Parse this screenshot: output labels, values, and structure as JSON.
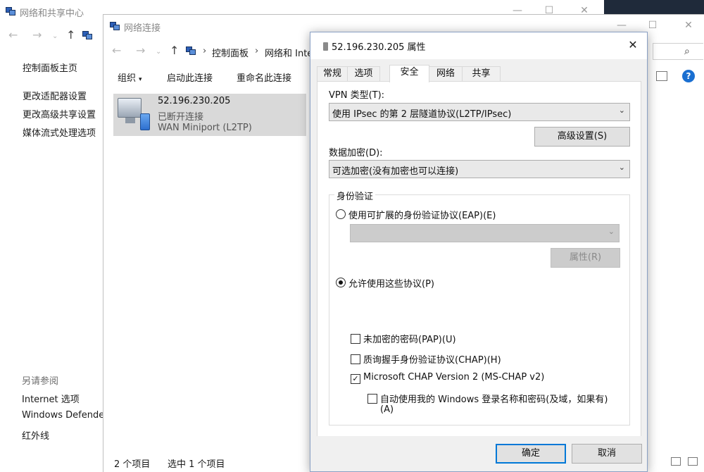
{
  "bg_window": {
    "title": "网络和共享中心",
    "sidebar": {
      "home_link": "控制面板主页",
      "links": [
        "更改适配器设置",
        "更改高级共享设置",
        "媒体流式处理选项"
      ],
      "see_also_label": "另请参阅",
      "see_also_links": [
        "Internet 选项",
        "Windows Defende",
        "红外线"
      ]
    }
  },
  "mid_window": {
    "title": "网络连接",
    "address": {
      "crumb1": "控制面板",
      "crumb2": "网络和 Inte",
      "separator": "›"
    },
    "toolbar": {
      "organize": "组织",
      "enable_connection": "启动此连接",
      "rename_connection": "重命名此连接"
    },
    "connection": {
      "name": "52.196.230.205",
      "status": "已断开连接",
      "device": "WAN Miniport (L2TP)"
    },
    "statusbar": {
      "item_count": "2 个项目",
      "selected_count": "选中 1 个项目"
    },
    "help_glyph": "?"
  },
  "dialog": {
    "title": "52.196.230.205 属性",
    "close_glyph": "✕",
    "tabs": [
      {
        "label": "常规",
        "active": false
      },
      {
        "label": "选项",
        "active": false
      },
      {
        "label": "安全",
        "active": true
      },
      {
        "label": "网络",
        "active": false
      },
      {
        "label": "共享",
        "active": false
      }
    ],
    "vpn_type": {
      "label": "VPN 类型(T):",
      "value": "使用 IPsec 的第 2 层隧道协议(L2TP/IPsec)"
    },
    "advanced_button": "高级设置(S)",
    "encryption": {
      "label": "数据加密(D):",
      "value": "可选加密(没有加密也可以连接)"
    },
    "auth": {
      "group_label": "身份验证",
      "eap_radio": {
        "label": "使用可扩展的身份验证协议(EAP)(E)",
        "checked": false
      },
      "eap_combo_value": "",
      "properties_button": "属性(R)",
      "protocols_radio": {
        "label": "允许使用这些协议(P)",
        "checked": true
      },
      "protocols": [
        {
          "label": "未加密的密码(PAP)(U)",
          "checked": false
        },
        {
          "label": "质询握手身份验证协议(CHAP)(H)",
          "checked": false
        },
        {
          "label": "Microsoft CHAP Version 2 (MS-CHAP v2)",
          "checked": true
        }
      ],
      "auto_windows_login": {
        "line1": "自动使用我的 Windows 登录名称和密码(及域，如果有)",
        "line2": "(A)",
        "checked": false
      }
    },
    "ok_button": "确定",
    "cancel_button": "取消"
  }
}
